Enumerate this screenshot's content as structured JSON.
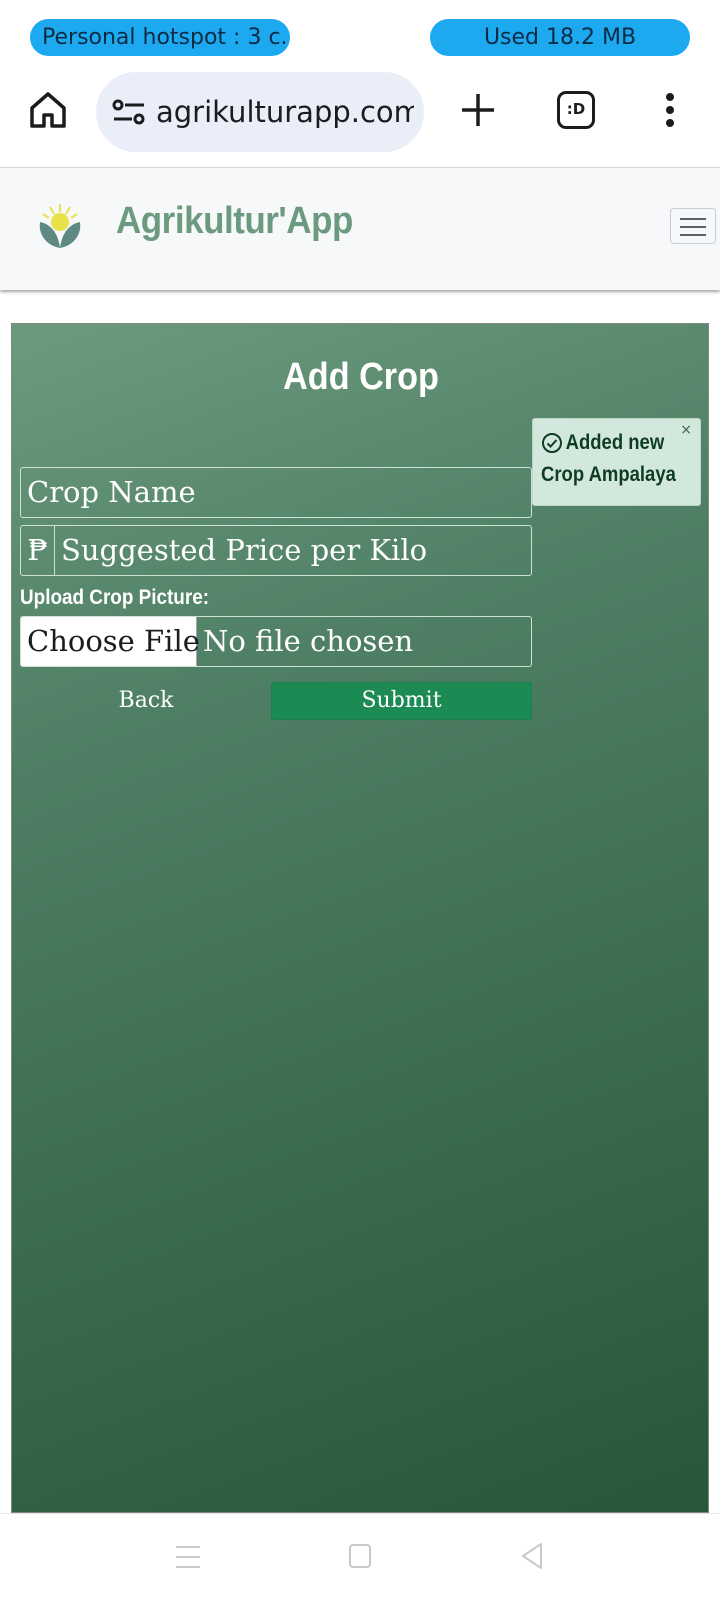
{
  "status_bar": {
    "hotspot_text": "Personal hotspot : 3 c...",
    "data_used": "Used  18.2 MB",
    "pill_color": "#1da9f0"
  },
  "browser": {
    "url": "agrikulturapp.com",
    "tab_label": ":D",
    "icons": [
      "home-icon",
      "site-settings-icon",
      "plus-icon",
      "tab-switcher-icon",
      "more-vert-icon"
    ]
  },
  "navbar": {
    "brand": "Agrikultur'App",
    "brand_color": "#6b9a7e",
    "icons": [
      "logo-icon",
      "hamburger-icon"
    ]
  },
  "form": {
    "title": "Add Crop",
    "crop_name_placeholder": "Crop Name",
    "currency_symbol": "₱",
    "price_placeholder": "Suggested Price per Kilo",
    "upload_label": "Upload Crop Picture:",
    "choose_file_label": "Choose File",
    "no_file_text": "No file chosen",
    "back_label": "Back",
    "submit_label": "Submit",
    "submit_color": "#1b8a53"
  },
  "toast": {
    "message": "Added new Crop Ampalaya",
    "close": "×",
    "background": "#d3e8dc"
  },
  "system_nav": {
    "icons": [
      "recents-icon",
      "home-square-icon",
      "back-triangle-icon"
    ]
  }
}
